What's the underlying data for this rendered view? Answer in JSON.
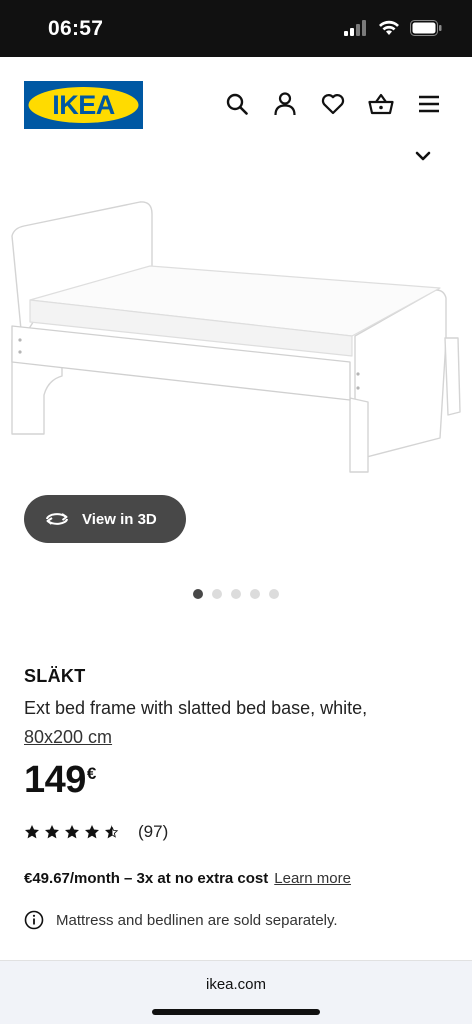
{
  "status_bar": {
    "time": "06:57",
    "icons": [
      "signal-icon",
      "wifi-icon",
      "battery-icon"
    ]
  },
  "header": {
    "logo_text": "IKEA",
    "brand_colors": {
      "blue": "#0058A3",
      "yellow": "#FFDB00"
    },
    "icons": [
      "search-icon",
      "account-icon",
      "heart-icon",
      "basket-icon",
      "menu-icon"
    ]
  },
  "gallery": {
    "view_3d_label": "View in 3D",
    "total_images": 5,
    "active_index": 0
  },
  "product": {
    "name": "SLÄKT",
    "description": "Ext bed frame with slatted bed base, white,",
    "size": "80x200 cm",
    "price": "149",
    "currency": "€",
    "rating": 4.5,
    "rating_count": "(97)",
    "installment": "€49.67/month – 3x at no extra cost",
    "learn_more": "Learn more",
    "info_note": "Mattress and bedlinen are sold separately."
  },
  "browser": {
    "url": "ikea.com"
  }
}
